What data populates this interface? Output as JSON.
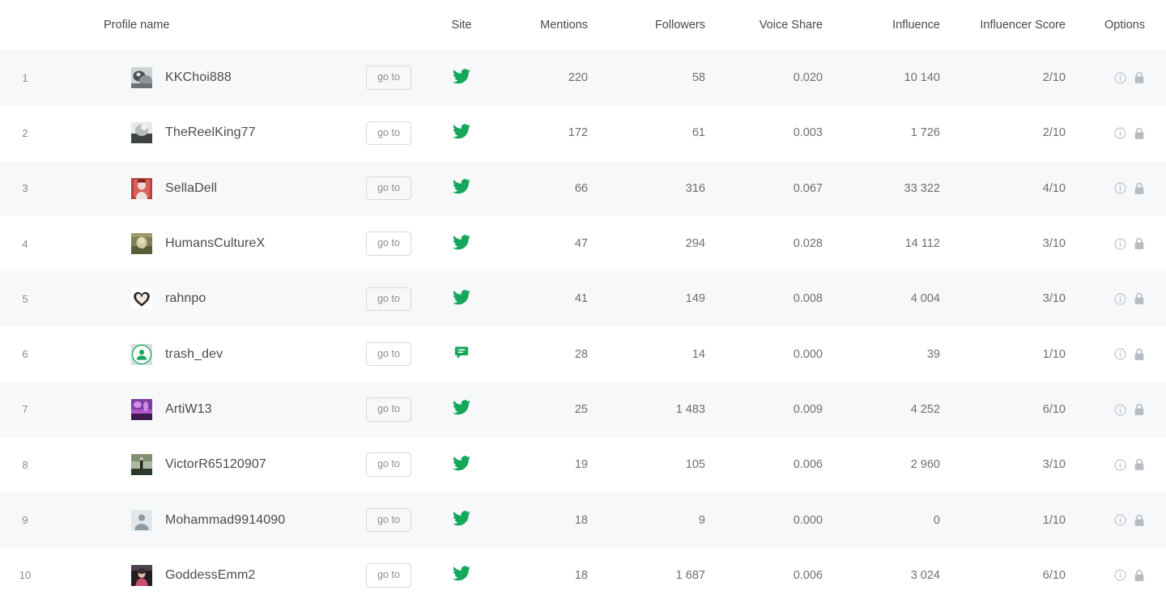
{
  "table": {
    "columns": [
      {
        "key": "rank",
        "label": ""
      },
      {
        "key": "profile",
        "label": "Profile name"
      },
      {
        "key": "goto",
        "label": ""
      },
      {
        "key": "site",
        "label": "Site"
      },
      {
        "key": "mentions",
        "label": "Mentions"
      },
      {
        "key": "followers",
        "label": "Followers"
      },
      {
        "key": "voice_share",
        "label": "Voice Share"
      },
      {
        "key": "influence",
        "label": "Influence"
      },
      {
        "key": "score",
        "label": "Influencer Score"
      },
      {
        "key": "options",
        "label": "Options"
      }
    ],
    "goto_label": "go to",
    "rows": [
      {
        "rank": "1",
        "name": "KKChoi888",
        "goto": "go to",
        "site_icon": "twitter-icon",
        "avatar": "photo-cat",
        "mentions": "220",
        "followers": "58",
        "voice_share": "0.020",
        "influence": "10 140",
        "score": "2/10"
      },
      {
        "rank": "2",
        "name": "TheReelKing77",
        "goto": "go to",
        "site_icon": "twitter-icon",
        "avatar": "photo-bw",
        "mentions": "172",
        "followers": "61",
        "voice_share": "0.003",
        "influence": "1 726",
        "score": "2/10"
      },
      {
        "rank": "3",
        "name": "SellaDell",
        "goto": "go to",
        "site_icon": "twitter-icon",
        "avatar": "photo-red",
        "mentions": "66",
        "followers": "316",
        "voice_share": "0.067",
        "influence": "33 322",
        "score": "4/10"
      },
      {
        "rank": "4",
        "name": "HumansCultureX",
        "goto": "go to",
        "site_icon": "twitter-icon",
        "avatar": "photo-nature",
        "mentions": "47",
        "followers": "294",
        "voice_share": "0.028",
        "influence": "14 112",
        "score": "3/10"
      },
      {
        "rank": "5",
        "name": "rahnpo",
        "goto": "go to",
        "site_icon": "twitter-icon",
        "avatar": "heart-glyph",
        "mentions": "41",
        "followers": "149",
        "voice_share": "0.008",
        "influence": "4 004",
        "score": "3/10"
      },
      {
        "rank": "6",
        "name": "trash_dev",
        "goto": "go to",
        "site_icon": "forum-icon",
        "avatar": "green-person-circle",
        "mentions": "28",
        "followers": "14",
        "voice_share": "0.000",
        "influence": "39",
        "score": "1/10"
      },
      {
        "rank": "7",
        "name": "ArtiW13",
        "goto": "go to",
        "site_icon": "twitter-icon",
        "avatar": "photo-purple",
        "mentions": "25",
        "followers": "1 483",
        "voice_share": "0.009",
        "influence": "4 252",
        "score": "6/10"
      },
      {
        "rank": "8",
        "name": "VictorR65120907",
        "goto": "go to",
        "site_icon": "twitter-icon",
        "avatar": "photo-outdoor",
        "mentions": "19",
        "followers": "105",
        "voice_share": "0.006",
        "influence": "2 960",
        "score": "3/10"
      },
      {
        "rank": "9",
        "name": "Mohammad9914090",
        "goto": "go to",
        "site_icon": "twitter-icon",
        "avatar": "default-person",
        "mentions": "18",
        "followers": "9",
        "voice_share": "0.000",
        "influence": "0",
        "score": "1/10"
      },
      {
        "rank": "10",
        "name": "GoddessEmm2",
        "goto": "go to",
        "site_icon": "twitter-icon",
        "avatar": "photo-dark",
        "mentions": "18",
        "followers": "1 687",
        "voice_share": "0.006",
        "influence": "3 024",
        "score": "6/10"
      }
    ],
    "option_icons": [
      "info-icon",
      "lock-icon"
    ]
  },
  "colors": {
    "site_green": "#15a75b",
    "row_stripe": "#f7f8f9",
    "row_plain": "#ffffff",
    "text": "#6d6d6d",
    "name_text": "#4c4c4c",
    "icon_gray": "#b6bcc2"
  }
}
